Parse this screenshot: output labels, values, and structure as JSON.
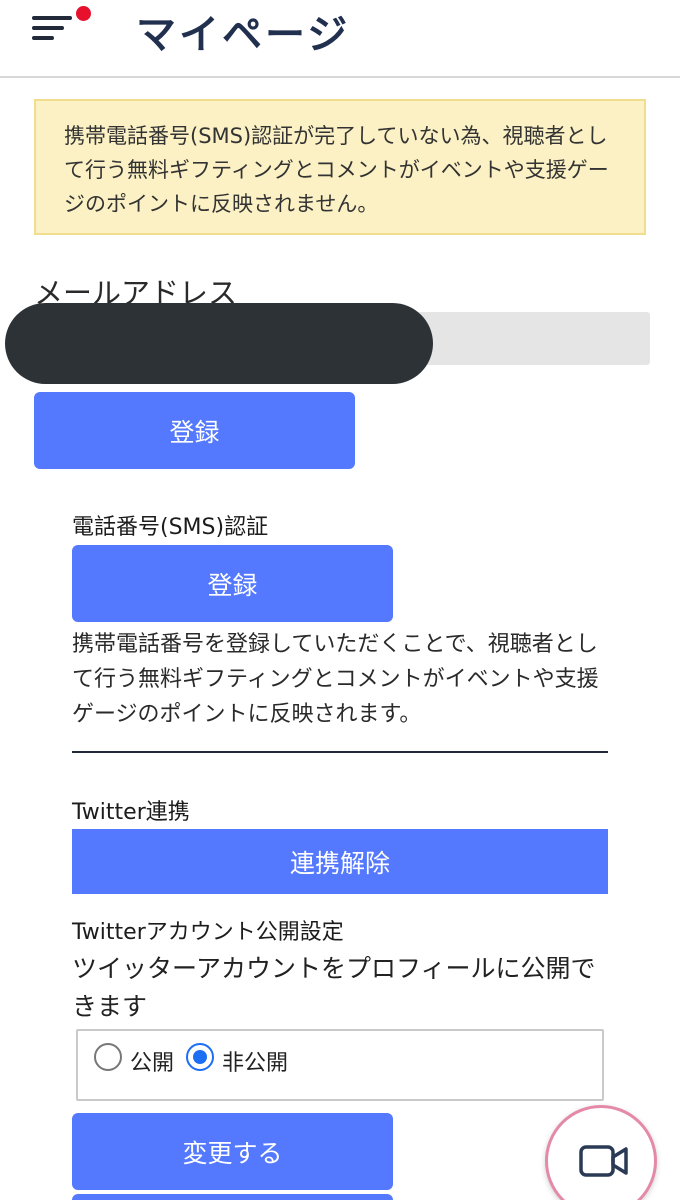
{
  "header": {
    "title": "マイページ",
    "menu_icon": "hamburger-menu-icon",
    "notification_color": "#e8112d"
  },
  "warning": {
    "text": "携帯電話番号(SMS)認証が完了していない為、視聴者として行う無料ギフティングとコメントがイベントや支援ゲージのポイントに反映されません。",
    "background": "#fbf1c4"
  },
  "email": {
    "label": "メールアドレス",
    "value": "",
    "submit_label": "登録"
  },
  "sms": {
    "label": "電話番号(SMS)認証",
    "submit_label": "登録",
    "description": "携帯電話番号を登録していただくことで、視聴者として行う無料ギフティングとコメントがイベントや支援ゲージのポイントに反映されます。"
  },
  "twitter": {
    "label": "Twitter連携",
    "unlink_label": "連携解除",
    "visibility_label": "Twitterアカウント公開設定",
    "visibility_description": "ツイッターアカウントをプロフィールに公開できます",
    "options": [
      {
        "label": "公開",
        "selected": false
      },
      {
        "label": "非公開",
        "selected": true
      }
    ],
    "change_label": "変更する"
  },
  "floating": {
    "icon": "video-camera-icon"
  },
  "colors": {
    "primary_button": "#5479ff",
    "title": "#21304f"
  }
}
